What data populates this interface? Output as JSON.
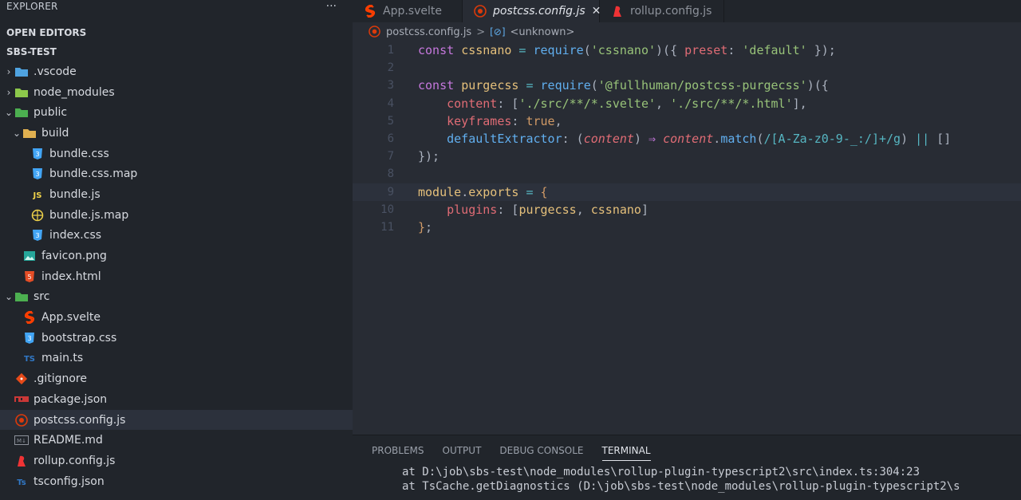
{
  "sidebar": {
    "title": "EXPLORER",
    "more_label": "···",
    "open_editors_label": "OPEN EDITORS",
    "project_label": "SBS-TEST",
    "tree": [
      {
        "name": ".vscode",
        "depth": 0,
        "chevron": "›",
        "icon": "vscode-folder-icon",
        "color": "#4fa3e0"
      },
      {
        "name": "node_modules",
        "depth": 0,
        "chevron": "›",
        "icon": "node-folder-icon",
        "color": "#8cc84b"
      },
      {
        "name": "public",
        "depth": 0,
        "chevron": "⌄",
        "icon": "public-folder-icon",
        "color": "#4caf50"
      },
      {
        "name": "build",
        "depth": 1,
        "chevron": "⌄",
        "icon": "build-folder-icon",
        "color": "#e0b050"
      },
      {
        "name": "bundle.css",
        "depth": 2,
        "chevron": "",
        "icon": "css-icon",
        "color": "#42a5f5"
      },
      {
        "name": "bundle.css.map",
        "depth": 2,
        "chevron": "",
        "icon": "css-map-icon",
        "color": "#42a5f5"
      },
      {
        "name": "bundle.js",
        "depth": 2,
        "chevron": "",
        "icon": "js-icon",
        "color": "#f0d34a"
      },
      {
        "name": "bundle.js.map",
        "depth": 2,
        "chevron": "",
        "icon": "js-map-icon",
        "color": "#f0d34a"
      },
      {
        "name": "index.css",
        "depth": 2,
        "chevron": "",
        "icon": "css-icon",
        "color": "#42a5f5"
      },
      {
        "name": "favicon.png",
        "depth": 1,
        "chevron": "",
        "icon": "image-icon",
        "color": "#26a69a"
      },
      {
        "name": "index.html",
        "depth": 1,
        "chevron": "",
        "icon": "html-icon",
        "color": "#e44d26"
      },
      {
        "name": "src",
        "depth": 0,
        "chevron": "⌄",
        "icon": "src-folder-icon",
        "color": "#4caf50"
      },
      {
        "name": "App.svelte",
        "depth": 1,
        "chevron": "",
        "icon": "svelte-icon",
        "color": "#ff3e00"
      },
      {
        "name": "bootstrap.css",
        "depth": 1,
        "chevron": "",
        "icon": "css-icon",
        "color": "#42a5f5"
      },
      {
        "name": "main.ts",
        "depth": 1,
        "chevron": "",
        "icon": "ts-icon",
        "color": "#3178c6"
      },
      {
        "name": ".gitignore",
        "depth": 0,
        "chevron": "",
        "icon": "git-icon",
        "color": "#e64a19"
      },
      {
        "name": "package.json",
        "depth": 0,
        "chevron": "",
        "icon": "npm-icon",
        "color": "#cb3837"
      },
      {
        "name": "postcss.config.js",
        "depth": 0,
        "chevron": "",
        "icon": "postcss-icon",
        "color": "#dd3a0a",
        "active": true
      },
      {
        "name": "README.md",
        "depth": 0,
        "chevron": "",
        "icon": "markdown-icon",
        "color": "#8d929b"
      },
      {
        "name": "rollup.config.js",
        "depth": 0,
        "chevron": "",
        "icon": "rollup-icon",
        "color": "#ef3335"
      },
      {
        "name": "tsconfig.json",
        "depth": 0,
        "chevron": "",
        "icon": "tsconfig-icon",
        "color": "#3178c6"
      }
    ]
  },
  "tabs": [
    {
      "label": "App.svelte",
      "icon": "svelte-icon",
      "color": "#ff3e00",
      "active": false
    },
    {
      "label": "postcss.config.js",
      "icon": "postcss-icon",
      "color": "#dd3a0a",
      "active": true,
      "close": "✕"
    },
    {
      "label": "rollup.config.js",
      "icon": "rollup-icon",
      "color": "#ef3335",
      "active": false
    }
  ],
  "breadcrumb": {
    "file": "postcss.config.js",
    "sep": ">",
    "symbol_icon": "[⊘]",
    "symbol": "<unknown>"
  },
  "code": {
    "current_line": 9,
    "lines": [
      [
        [
          "kw",
          "const "
        ],
        [
          "var",
          "cssnano"
        ],
        [
          "op",
          " = "
        ],
        [
          "fn",
          "require"
        ],
        [
          "pun",
          "("
        ],
        [
          "str",
          "'cssnano'"
        ],
        [
          "pun",
          ")({ "
        ],
        [
          "prop",
          "preset"
        ],
        [
          "pun",
          ": "
        ],
        [
          "str",
          "'default'"
        ],
        [
          "pun",
          " });"
        ]
      ],
      [],
      [
        [
          "kw",
          "const "
        ],
        [
          "var",
          "purgecss"
        ],
        [
          "op",
          " = "
        ],
        [
          "fn",
          "require"
        ],
        [
          "pun",
          "("
        ],
        [
          "str",
          "'@fullhuman/postcss-purgecss'"
        ],
        [
          "pun",
          ")({"
        ]
      ],
      [
        [
          "pun",
          "    "
        ],
        [
          "prop",
          "content"
        ],
        [
          "pun",
          ": ["
        ],
        [
          "str",
          "'./src/**/*.svelte'"
        ],
        [
          "pun",
          ", "
        ],
        [
          "str",
          "'./src/**/*.html'"
        ],
        [
          "pun",
          "],"
        ]
      ],
      [
        [
          "pun",
          "    "
        ],
        [
          "prop",
          "keyframes"
        ],
        [
          "pun",
          ": "
        ],
        [
          "bool",
          "true"
        ],
        [
          "pun",
          ","
        ]
      ],
      [
        [
          "pun",
          "    "
        ],
        [
          "fn",
          "defaultExtractor"
        ],
        [
          "pun",
          ": ("
        ],
        [
          "param",
          "content"
        ],
        [
          "pun",
          ") "
        ],
        [
          "kw",
          "⇒ "
        ],
        [
          "param",
          "content"
        ],
        [
          "pun",
          "."
        ],
        [
          "fn",
          "match"
        ],
        [
          "pun",
          "("
        ],
        [
          "regex",
          "/[A-Za-z0-9-_:/]+/g"
        ],
        [
          "pun",
          ") "
        ],
        [
          "op",
          "||"
        ],
        [
          "pun",
          " []"
        ]
      ],
      [
        [
          "pun",
          "});"
        ]
      ],
      [],
      [
        [
          "var",
          "module"
        ],
        [
          "pun",
          "."
        ],
        [
          "var",
          "exports"
        ],
        [
          "op",
          " = "
        ],
        [
          "rb",
          "{"
        ]
      ],
      [
        [
          "pun",
          "    "
        ],
        [
          "prop",
          "plugins"
        ],
        [
          "pun",
          ": ["
        ],
        [
          "var",
          "purgecss"
        ],
        [
          "pun",
          ", "
        ],
        [
          "var",
          "cssnano"
        ],
        [
          "pun",
          "]"
        ]
      ],
      [
        [
          "rb",
          "}"
        ],
        [
          "pun",
          ";"
        ]
      ]
    ]
  },
  "panel": {
    "tabs": [
      {
        "label": "PROBLEMS",
        "active": false
      },
      {
        "label": "OUTPUT",
        "active": false
      },
      {
        "label": "DEBUG CONSOLE",
        "active": false
      },
      {
        "label": "TERMINAL",
        "active": true
      }
    ],
    "terminal_lines": [
      "at D:\\job\\sbs-test\\node_modules\\rollup-plugin-typescript2\\src\\index.ts:304:23",
      "at TsCache.getDiagnostics (D:\\job\\sbs-test\\node_modules\\rollup-plugin-typescript2\\s"
    ]
  }
}
